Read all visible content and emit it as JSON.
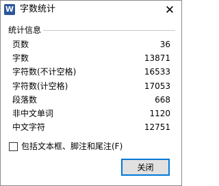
{
  "window": {
    "title": "字数统计",
    "app_icon_letter": "W",
    "app_icon_color": "#2b579a",
    "close_glyph": "✕"
  },
  "stats": {
    "group_label": "统计信息",
    "rows": [
      {
        "label": "页数",
        "value": "36"
      },
      {
        "label": "字数",
        "value": "13871"
      },
      {
        "label": "字符数(不计空格)",
        "value": "16533"
      },
      {
        "label": "字符数(计空格)",
        "value": "17053"
      },
      {
        "label": "段落数",
        "value": "668"
      },
      {
        "label": "非中文单词",
        "value": "1120"
      },
      {
        "label": "中文字符",
        "value": "12751"
      }
    ]
  },
  "options": {
    "include_textboxes_label": "包括文本框、脚注和尾注(F)",
    "include_textboxes_checked": false
  },
  "buttons": {
    "close_label": "关闭",
    "accent_color": "#0078d7"
  }
}
